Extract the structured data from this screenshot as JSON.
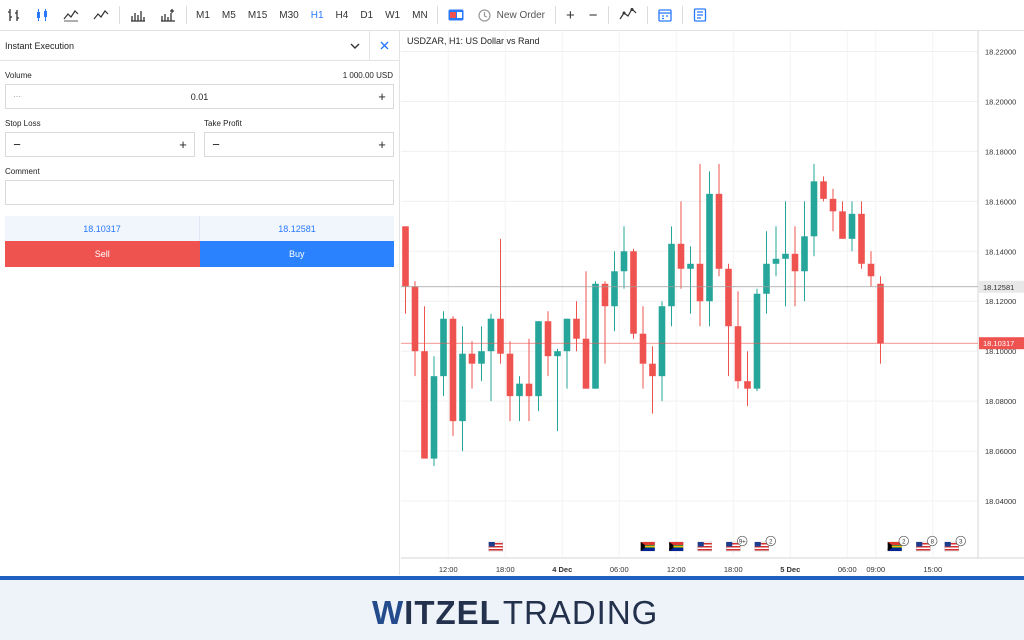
{
  "toolbar": {
    "timeframes": [
      "M1",
      "M5",
      "M15",
      "M30",
      "H1",
      "H4",
      "D1",
      "W1",
      "MN"
    ],
    "active_timeframe": "H1",
    "new_order_label": "New Order",
    "accent": "#2979ff"
  },
  "panel": {
    "title": "Instant Execution",
    "volume_label": "Volume",
    "volume_amount": "1 000.00 USD",
    "volume_value": "0.01",
    "volume_minus": "···",
    "stop_loss_label": "Stop Loss",
    "take_profit_label": "Take Profit",
    "comment_label": "Comment",
    "bid": "18.10317",
    "ask": "18.12581",
    "sell_label": "Sell",
    "buy_label": "Buy",
    "sell_color": "#ef5350",
    "buy_color": "#2a82ff"
  },
  "chart_data": {
    "type": "candlestick",
    "title": "USDZAR, H1: US Dollar vs Rand",
    "ylim": [
      18.02,
      18.225
    ],
    "y_ticks": [
      "18.22000",
      "18.20000",
      "18.18000",
      "18.16000",
      "18.14000",
      "18.12000",
      "18.10000",
      "18.08000",
      "18.06000",
      "18.04000"
    ],
    "x_ticks": [
      {
        "label": "12:00",
        "i": 4.5
      },
      {
        "label": "18:00",
        "i": 10.5
      },
      {
        "label": "4 Dec",
        "i": 16.5,
        "bold": true
      },
      {
        "label": "06:00",
        "i": 22.5
      },
      {
        "label": "12:00",
        "i": 28.5
      },
      {
        "label": "18:00",
        "i": 34.5
      },
      {
        "label": "5 Dec",
        "i": 40.5,
        "bold": true
      },
      {
        "label": "06:00",
        "i": 46.5
      },
      {
        "label": "09:00",
        "i": 49.5
      },
      {
        "label": "15:00",
        "i": 55.5
      }
    ],
    "ask_line": {
      "label": "18.12581",
      "value": 18.1258
    },
    "bid_line": {
      "label": "18.10317",
      "value": 18.1032
    },
    "candles": [
      [
        18.15,
        18.15,
        18.115,
        18.126
      ],
      [
        18.126,
        18.128,
        18.09,
        18.1
      ],
      [
        18.1,
        18.118,
        18.075,
        18.057
      ],
      [
        18.057,
        18.098,
        18.054,
        18.09
      ],
      [
        18.09,
        18.116,
        18.082,
        18.113
      ],
      [
        18.113,
        18.114,
        18.066,
        18.072
      ],
      [
        18.072,
        18.11,
        18.06,
        18.099
      ],
      [
        18.099,
        18.104,
        18.085,
        18.095
      ],
      [
        18.095,
        18.11,
        18.088,
        18.1
      ],
      [
        18.1,
        18.115,
        18.08,
        18.113
      ],
      [
        18.113,
        18.145,
        18.095,
        18.099
      ],
      [
        18.099,
        18.104,
        18.072,
        18.082
      ],
      [
        18.082,
        18.09,
        18.072,
        18.087
      ],
      [
        18.087,
        18.105,
        18.072,
        18.082
      ],
      [
        18.082,
        18.112,
        18.076,
        18.112
      ],
      [
        18.112,
        18.116,
        18.09,
        18.098
      ],
      [
        18.098,
        18.101,
        18.068,
        18.1
      ],
      [
        18.1,
        18.113,
        18.085,
        18.113
      ],
      [
        18.113,
        18.12,
        18.1,
        18.105
      ],
      [
        18.105,
        18.132,
        18.085,
        18.085
      ],
      [
        18.085,
        18.128,
        18.085,
        18.127
      ],
      [
        18.127,
        18.128,
        18.095,
        18.118
      ],
      [
        18.118,
        18.14,
        18.108,
        18.132
      ],
      [
        18.132,
        18.15,
        18.125,
        18.14
      ],
      [
        18.14,
        18.141,
        18.105,
        18.107
      ],
      [
        18.107,
        18.118,
        18.085,
        18.095
      ],
      [
        18.095,
        18.102,
        18.075,
        18.09
      ],
      [
        18.09,
        18.12,
        18.08,
        18.118
      ],
      [
        18.118,
        18.15,
        18.11,
        18.143
      ],
      [
        18.143,
        18.16,
        18.125,
        18.133
      ],
      [
        18.133,
        18.142,
        18.115,
        18.135
      ],
      [
        18.135,
        18.175,
        18.11,
        18.12
      ],
      [
        18.12,
        18.172,
        18.11,
        18.163
      ],
      [
        18.163,
        18.175,
        18.13,
        18.133
      ],
      [
        18.133,
        18.135,
        18.09,
        18.11
      ],
      [
        18.11,
        18.124,
        18.085,
        18.088
      ],
      [
        18.088,
        18.1,
        18.078,
        18.085
      ],
      [
        18.085,
        18.125,
        18.084,
        18.123
      ],
      [
        18.123,
        18.148,
        18.115,
        18.135
      ],
      [
        18.135,
        18.15,
        18.13,
        18.137
      ],
      [
        18.137,
        18.16,
        18.118,
        18.139
      ],
      [
        18.139,
        18.15,
        18.118,
        18.132
      ],
      [
        18.132,
        18.16,
        18.12,
        18.146
      ],
      [
        18.146,
        18.175,
        18.138,
        18.168
      ],
      [
        18.168,
        18.17,
        18.16,
        18.161
      ],
      [
        18.161,
        18.165,
        18.148,
        18.156
      ],
      [
        18.156,
        18.16,
        18.145,
        18.145
      ],
      [
        18.145,
        18.16,
        18.14,
        18.155
      ],
      [
        18.155,
        18.16,
        18.133,
        18.135
      ],
      [
        18.135,
        18.14,
        18.126,
        18.13
      ],
      [
        18.127,
        18.13,
        18.095,
        18.103
      ]
    ],
    "events": [
      {
        "i": 9.5,
        "flag": "us"
      },
      {
        "i": 25.5,
        "flag": "za"
      },
      {
        "i": 28.5,
        "flag": "za"
      },
      {
        "i": 31.5,
        "flag": "us"
      },
      {
        "i": 34.5,
        "flag": "us",
        "badge": "9+"
      },
      {
        "i": 37.5,
        "flag": "us",
        "badge": "2"
      },
      {
        "i": 51.5,
        "flag": "za",
        "badge": "2"
      },
      {
        "i": 54.5,
        "flag": "us",
        "badge": "8"
      },
      {
        "i": 57.5,
        "flag": "us",
        "badge": "3"
      }
    ],
    "up_color": "#26a69a",
    "down_color": "#ef5350"
  },
  "footer": {
    "logo_w": "W",
    "logo_rest": "ITZEL",
    "logo_trading": "TRADING"
  }
}
